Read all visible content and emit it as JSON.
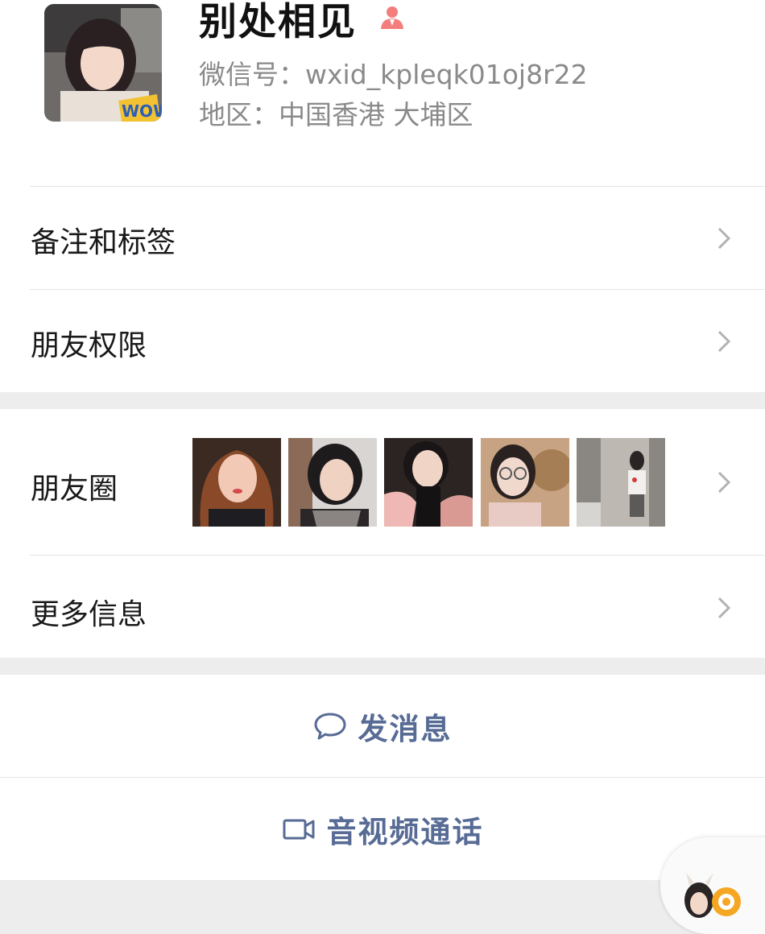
{
  "profile": {
    "name": "别处相见",
    "wechat_id": "微信号：wxid_kpleqk01oj8r22",
    "region": "地区：中国香港 大埔区",
    "gender_icon": "female-icon",
    "accent_color": "#f37e7d"
  },
  "menu": {
    "remarks_label": "备注和标签",
    "permissions_label": "朋友权限",
    "moments_label": "朋友圈",
    "more_info_label": "更多信息"
  },
  "moments": {
    "thumbnail_count": 5
  },
  "actions": {
    "message_label": "发消息",
    "call_label": "音视频通话",
    "link_color": "#576b95"
  },
  "colors": {
    "page_background": "#ededed",
    "section_background": "#ffffff",
    "chevron": "#b2b2b2"
  }
}
